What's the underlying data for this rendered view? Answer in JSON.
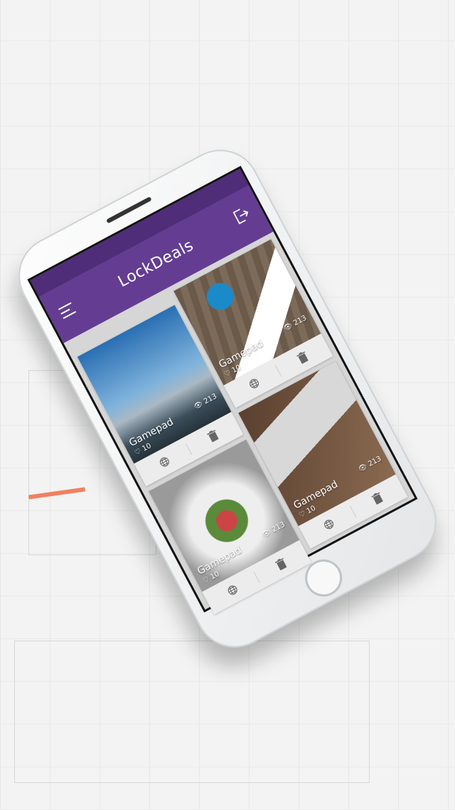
{
  "app": {
    "title": "LockDeals",
    "menu_icon": "hamburger-icon",
    "logout_icon": "logout-icon",
    "accent": "#643d92"
  },
  "cards": [
    {
      "title": "Gamepad",
      "likes": "10",
      "views": "213",
      "image": "mountains"
    },
    {
      "title": "Gamepad",
      "likes": "10",
      "views": "213",
      "image": "food"
    },
    {
      "title": "Gamepad",
      "likes": "10",
      "views": "213",
      "image": "desk-coffee"
    },
    {
      "title": "Gamepad",
      "likes": "10",
      "views": "213",
      "image": "desk-laptop"
    }
  ]
}
